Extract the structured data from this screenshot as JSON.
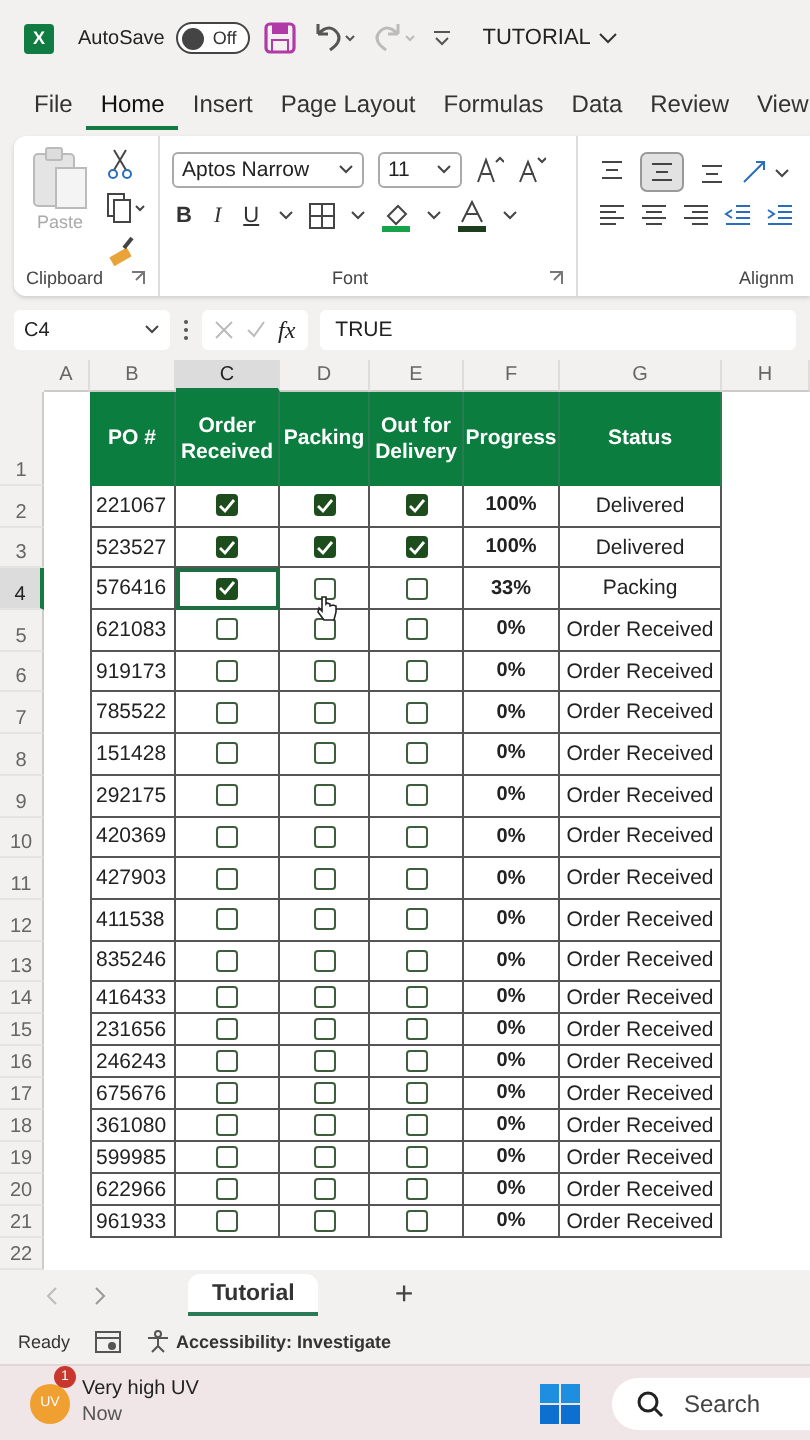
{
  "title_bar": {
    "app_icon": "X",
    "autosave_label": "AutoSave",
    "autosave": {
      "label": "Off",
      "on": false
    },
    "title": "TUTORIAL"
  },
  "menu_tabs": [
    {
      "label": "File",
      "selected": false
    },
    {
      "label": "Home",
      "selected": true
    },
    {
      "label": "Insert",
      "selected": false
    },
    {
      "label": "Page Layout",
      "selected": false
    },
    {
      "label": "Formulas",
      "selected": false
    },
    {
      "label": "Data",
      "selected": false
    },
    {
      "label": "Review",
      "selected": false
    },
    {
      "label": "View",
      "selected": false
    }
  ],
  "ribbon": {
    "paste_label": "Paste",
    "clipboard_label": "Clipboard",
    "font_name": "Aptos Narrow",
    "font_size": "11",
    "bold": "B",
    "italic": "I",
    "underline": "U",
    "font_label": "Font",
    "alignment_label": "Alignm"
  },
  "formula_bar": {
    "name_box": "C4",
    "fx": "fx",
    "value": "TRUE"
  },
  "sheet": {
    "columns": [
      {
        "letter": "A",
        "selected": false
      },
      {
        "letter": "B",
        "selected": false
      },
      {
        "letter": "C",
        "selected": true
      },
      {
        "letter": "D",
        "selected": false
      },
      {
        "letter": "E",
        "selected": false
      },
      {
        "letter": "F",
        "selected": false
      },
      {
        "letter": "G",
        "selected": false
      },
      {
        "letter": "H",
        "selected": false
      }
    ],
    "header_row": {
      "number": "1",
      "cells": [
        "PO #",
        "Order Received",
        "Packing",
        "Out for Delivery",
        "Progress",
        "Status"
      ]
    },
    "rows": [
      {
        "number": "2",
        "selected": false,
        "po": "221067",
        "checks": [
          true,
          true,
          true
        ],
        "progress": "100%",
        "status": "Delivered"
      },
      {
        "number": "3",
        "selected": false,
        "po": "523527",
        "checks": [
          true,
          true,
          true
        ],
        "progress": "100%",
        "status": "Delivered"
      },
      {
        "number": "4",
        "selected": true,
        "po": "576416",
        "checks": [
          true,
          false,
          false
        ],
        "progress": "33%",
        "status": "Packing"
      },
      {
        "number": "5",
        "selected": false,
        "po": "621083",
        "checks": [
          false,
          false,
          false
        ],
        "progress": "0%",
        "status": "Order Received"
      },
      {
        "number": "6",
        "selected": false,
        "po": "919173",
        "checks": [
          false,
          false,
          false
        ],
        "progress": "0%",
        "status": "Order Received"
      },
      {
        "number": "7",
        "selected": false,
        "po": "785522",
        "checks": [
          false,
          false,
          false
        ],
        "progress": "0%",
        "status": "Order Received"
      },
      {
        "number": "8",
        "selected": false,
        "po": "151428",
        "checks": [
          false,
          false,
          false
        ],
        "progress": "0%",
        "status": "Order Received"
      },
      {
        "number": "9",
        "selected": false,
        "po": "292175",
        "checks": [
          false,
          false,
          false
        ],
        "progress": "0%",
        "status": "Order Received"
      },
      {
        "number": "10",
        "selected": false,
        "po": "420369",
        "checks": [
          false,
          false,
          false
        ],
        "progress": "0%",
        "status": "Order Received"
      },
      {
        "number": "11",
        "selected": false,
        "po": "427903",
        "checks": [
          false,
          false,
          false
        ],
        "progress": "0%",
        "status": "Order Received"
      },
      {
        "number": "12",
        "selected": false,
        "po": "411538",
        "checks": [
          false,
          false,
          false
        ],
        "progress": "0%",
        "status": "Order Received"
      },
      {
        "number": "13",
        "selected": false,
        "po": "835246",
        "checks": [
          false,
          false,
          false
        ],
        "progress": "0%",
        "status": "Order Received"
      },
      {
        "number": "14",
        "selected": false,
        "po": "416433",
        "checks": [
          false,
          false,
          false
        ],
        "progress": "0%",
        "status": "Order Received"
      },
      {
        "number": "15",
        "selected": false,
        "po": "231656",
        "checks": [
          false,
          false,
          false
        ],
        "progress": "0%",
        "status": "Order Received"
      },
      {
        "number": "16",
        "selected": false,
        "po": "246243",
        "checks": [
          false,
          false,
          false
        ],
        "progress": "0%",
        "status": "Order Received"
      },
      {
        "number": "17",
        "selected": false,
        "po": "675676",
        "checks": [
          false,
          false,
          false
        ],
        "progress": "0%",
        "status": "Order Received"
      },
      {
        "number": "18",
        "selected": false,
        "po": "361080",
        "checks": [
          false,
          false,
          false
        ],
        "progress": "0%",
        "status": "Order Received"
      },
      {
        "number": "19",
        "selected": false,
        "po": "599985",
        "checks": [
          false,
          false,
          false
        ],
        "progress": "0%",
        "status": "Order Received"
      },
      {
        "number": "20",
        "selected": false,
        "po": "622966",
        "checks": [
          false,
          false,
          false
        ],
        "progress": "0%",
        "status": "Order Received"
      },
      {
        "number": "21",
        "selected": false,
        "po": "961933",
        "checks": [
          false,
          false,
          false
        ],
        "progress": "0%",
        "status": "Order Received"
      }
    ],
    "empty_row": "22"
  },
  "sheet_tabs": {
    "tabs": [
      {
        "label": "Tutorial",
        "selected": true
      }
    ],
    "add": "+"
  },
  "status_bar": {
    "ready": "Ready",
    "accessibility": "Accessibility: Investigate"
  },
  "taskbar": {
    "widget": {
      "avatar": "UV",
      "badge": "1",
      "title": "Very high UV",
      "subtitle": "Now"
    },
    "search": "Search"
  }
}
